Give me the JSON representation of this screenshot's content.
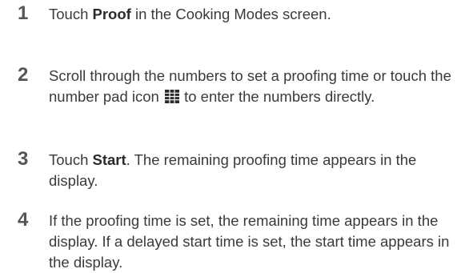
{
  "steps": [
    {
      "number": "1",
      "pre": "Touch ",
      "bold": "Proof",
      "post": " in the Cooking Modes screen."
    },
    {
      "number": "2",
      "pre": "Scroll through the numbers to set a proofing time or touch the number pad icon ",
      "icon": "number-pad-icon",
      "post": " to enter the numbers directly."
    },
    {
      "number": "3",
      "pre": "Touch ",
      "bold": "Start",
      "post": ". The remaining proofing time appears in the display."
    },
    {
      "number": "4",
      "text": "If the proofing time is set, the remaining time appears in the display. If a delayed start time is set, the start time appears in the display."
    }
  ]
}
